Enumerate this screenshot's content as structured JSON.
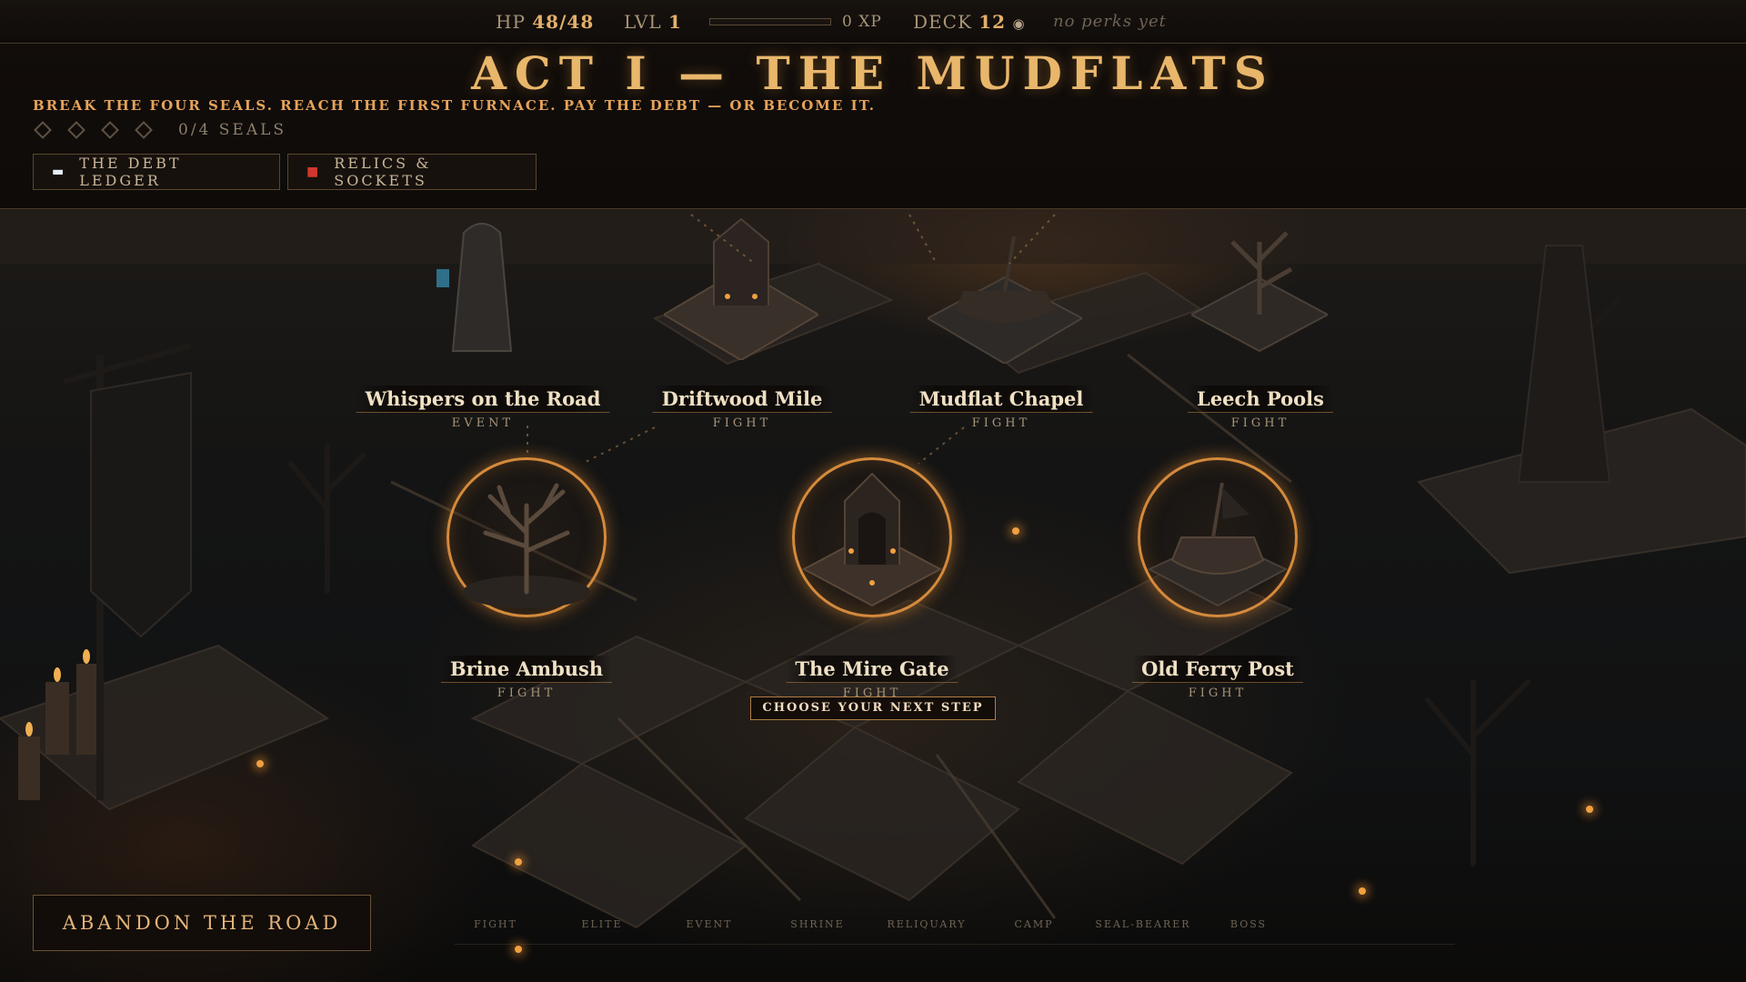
{
  "hud": {
    "hp_label": "HP",
    "hp_value": "48/48",
    "lvl_label": "LVL",
    "lvl_value": "1",
    "xp_text": "0 XP",
    "xp_progress": 0,
    "deck_label": "DECK",
    "deck_value": "12",
    "perks_text": "no perks yet"
  },
  "header": {
    "act_title": "ACT I — THE MUDFLATS",
    "subtitle": "BREAK THE FOUR SEALS. REACH THE FIRST FURNACE. PAY THE DEBT — OR BECOME IT.",
    "seals_total": 4,
    "seals_broken": 0,
    "seals_text": "0/4 SEALS",
    "buttons": {
      "ledger": "THE DEBT LEDGER",
      "relics": "RELICS & SOCKETS"
    }
  },
  "map": {
    "upper_nodes": [
      {
        "name": "Whispers on the Road",
        "kind": "EVENT"
      },
      {
        "name": "Driftwood Mile",
        "kind": "FIGHT"
      },
      {
        "name": "Mudflat Chapel",
        "kind": "FIGHT"
      },
      {
        "name": "Leech Pools",
        "kind": "FIGHT"
      }
    ],
    "choice_nodes": [
      {
        "name": "Brine Ambush",
        "kind": "FIGHT"
      },
      {
        "name": "The Mire Gate",
        "kind": "FIGHT"
      },
      {
        "name": "Old Ferry Post",
        "kind": "FIGHT"
      }
    ],
    "prompt": "CHOOSE YOUR NEXT STEP"
  },
  "footer": {
    "abandon": "ABANDON THE ROAD",
    "legend": [
      "FIGHT",
      "ELITE",
      "EVENT",
      "SHRINE",
      "RELIQUARY",
      "CAMP",
      "SEAL-BEARER",
      "BOSS"
    ]
  },
  "colors": {
    "accent": "#e9b76b",
    "ring": "#d48a3c",
    "relic_icon": "#d0362e"
  }
}
